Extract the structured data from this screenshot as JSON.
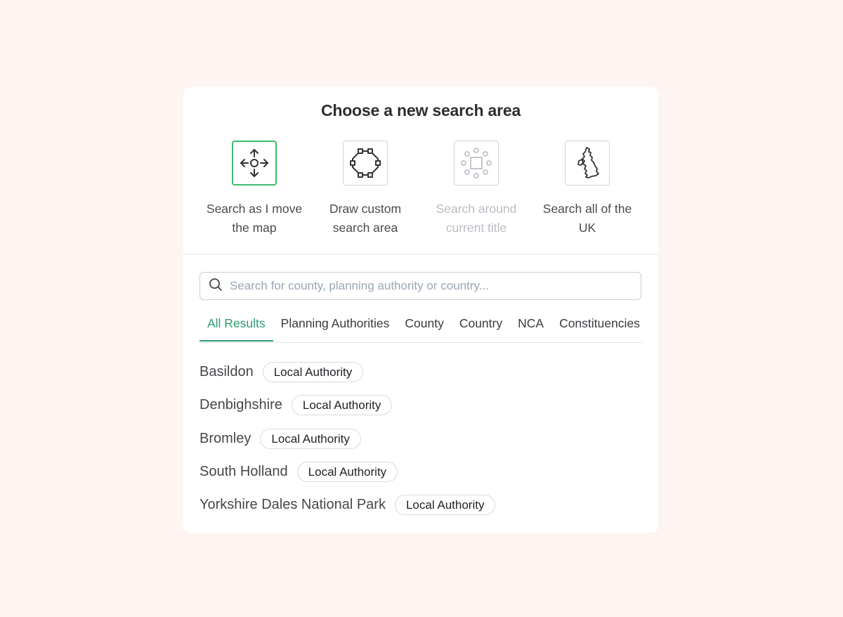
{
  "title": "Choose a new search area",
  "options": [
    {
      "label": "Search as I move the map",
      "icon": "move-arrows-icon",
      "selected": true,
      "disabled": false
    },
    {
      "label": "Draw custom search area",
      "icon": "polygon-draw-icon",
      "selected": false,
      "disabled": false
    },
    {
      "label": "Search around current title",
      "icon": "radius-around-icon",
      "selected": false,
      "disabled": true
    },
    {
      "label": "Search all of the UK",
      "icon": "uk-map-icon",
      "selected": false,
      "disabled": false
    }
  ],
  "search": {
    "placeholder": "Search for county, planning authority or country...",
    "value": "",
    "icon": "search-icon"
  },
  "tabs": [
    {
      "label": "All Results",
      "active": true
    },
    {
      "label": "Planning Authorities",
      "active": false
    },
    {
      "label": "County",
      "active": false
    },
    {
      "label": "Country",
      "active": false
    },
    {
      "label": "NCA",
      "active": false
    },
    {
      "label": "Constituencies",
      "active": false
    }
  ],
  "results": [
    {
      "name": "Basildon",
      "badge": "Local Authority"
    },
    {
      "name": "Denbighshire",
      "badge": "Local Authority"
    },
    {
      "name": "Bromley",
      "badge": "Local Authority"
    },
    {
      "name": "South Holland",
      "badge": "Local Authority"
    },
    {
      "name": "Yorkshire Dales National Park",
      "badge": "Local Authority"
    }
  ],
  "colors": {
    "background": "#fef5f2",
    "selected_border": "#3cbb6c",
    "active_tab": "#2e9a6f",
    "disabled_text": "#b9bcc2"
  }
}
